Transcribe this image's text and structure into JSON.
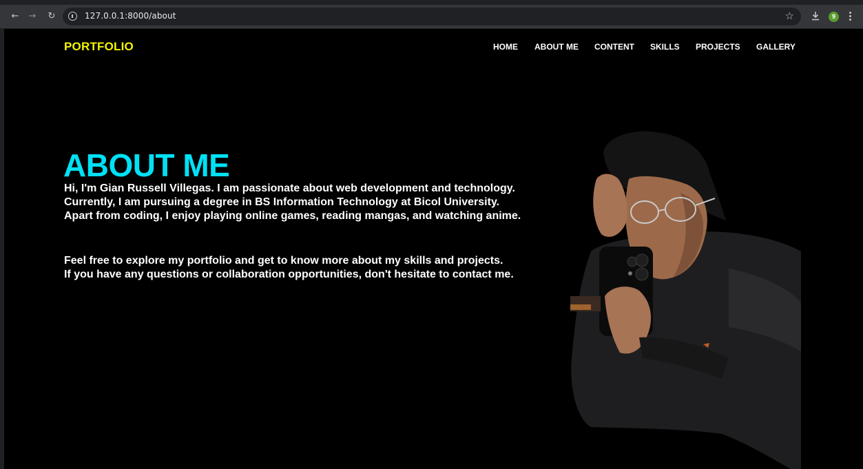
{
  "browser": {
    "url": "127.0.0.1:8000/about",
    "profile_initial": "9",
    "icons": {
      "back": "arrow-left-icon",
      "forward": "arrow-right-icon",
      "reload": "reload-icon",
      "info": "info-icon",
      "bookmark": "star-icon",
      "download": "download-icon",
      "menu": "vertical-dots-icon"
    }
  },
  "site": {
    "brand": "PORTFOLIO",
    "nav": {
      "home": "HOME",
      "about": "ABOUT ME",
      "content": "CONTENT",
      "skills": "SKILLS",
      "projects": "PROJECTS",
      "gallery": "GALLERY"
    }
  },
  "about": {
    "heading": "ABOUT ME",
    "paragraph1": [
      "Hi, I'm Gian Russell Villegas. I am passionate about web development and technology.",
      "Currently, I am pursuing a degree in BS Information Technology at Bicol University.",
      "Apart from coding, I enjoy playing online games, reading mangas, and watching anime."
    ],
    "paragraph2": [
      "Feel free to explore my portfolio and get to know more about my skills and projects.",
      "If you have any questions or collaboration opportunities, don't hesitate to contact me."
    ]
  },
  "colors": {
    "brand": "#f5f500",
    "heading": "#00e1f5",
    "page_background": "#000000",
    "text": "#ffffff"
  }
}
